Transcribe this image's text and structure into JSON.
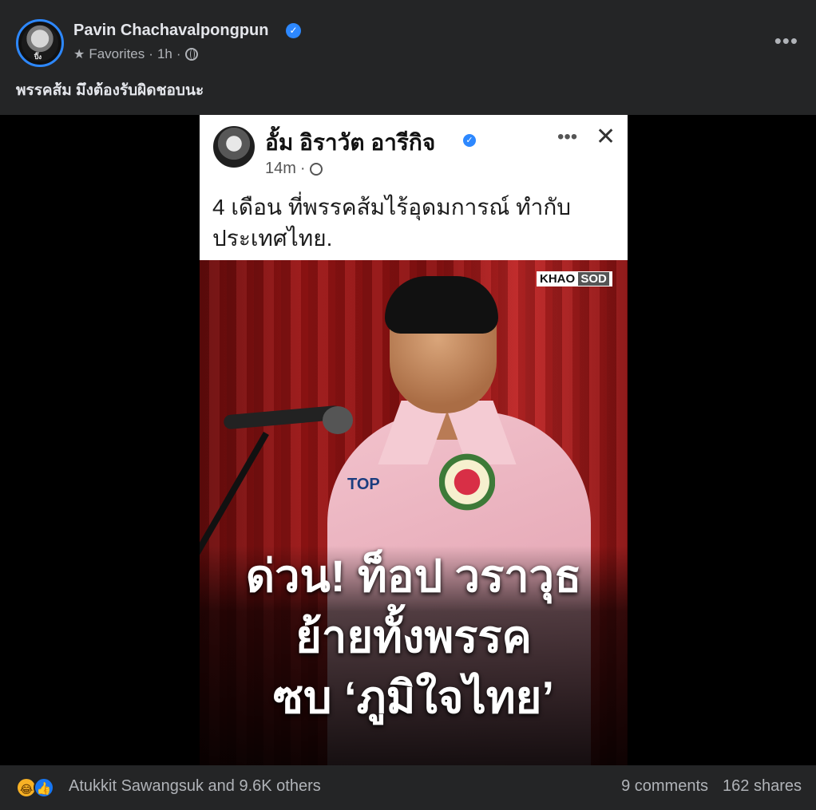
{
  "post": {
    "author": "Pavin Chachavalpongpun",
    "audience": "Favorites",
    "time": "1h",
    "caption": "พรรคส้ม มึงต้องรับผิดชอบนะ",
    "avatar_label": "ปิ๊ง"
  },
  "embedded": {
    "name": "อั้ม อิราวัต อารีกิจ",
    "time": "14m",
    "text": "4 เดือน ที่พรรคส้มไร้อุดมการณ์ ทำกับประเทศไทย.",
    "logo_left": "KHAO",
    "logo_right": "SOD",
    "shirt_logo": "TOP",
    "headline_1": "ด่วน! ท็อป วราวุธ",
    "headline_2": "ย้ายทั้งพรรค",
    "headline_3": "ซบ ‘ภูมิใจไทย’"
  },
  "footer": {
    "reactions_text": "Atukkit Sawangsuk and 9.6K others",
    "comments": "9 comments",
    "shares": "162 shares"
  }
}
